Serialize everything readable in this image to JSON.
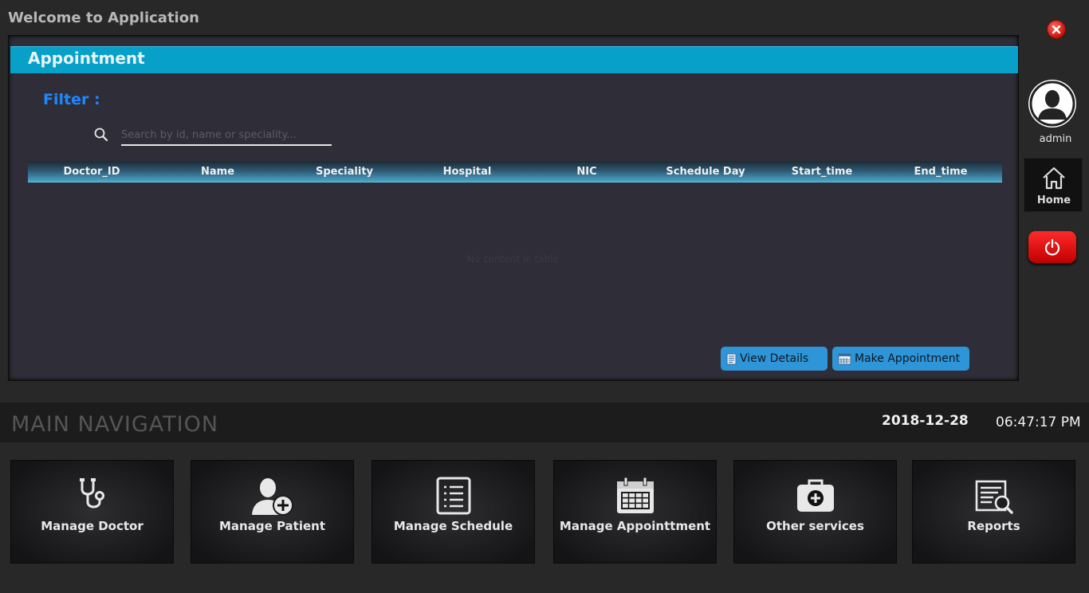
{
  "window": {
    "title": "Welcome to Application"
  },
  "panel": {
    "title": "Appointment",
    "filter_label": "Filter :",
    "search_placeholder": "Search by id, name or speciality...",
    "table": {
      "columns": [
        "Doctor_ID",
        "Name",
        "Speciality",
        "Hospital",
        "NIC",
        "Schedule Day",
        "Start_time",
        "End_time"
      ],
      "empty_text": "No content in table"
    },
    "buttons": {
      "view_details": "View Details",
      "make_appointment": "Make Appointment"
    }
  },
  "user": {
    "name": "admin"
  },
  "sidebar": {
    "home_label": "Home"
  },
  "navigation": {
    "title": "MAIN NAVIGATION",
    "date": "2018-12-28",
    "time": "06:47:17 PM",
    "tiles": [
      {
        "label": "Manage Doctor",
        "icon": "stethoscope-icon"
      },
      {
        "label": "Manage Patient",
        "icon": "add-user-icon"
      },
      {
        "label": "Manage Schedule",
        "icon": "list-icon"
      },
      {
        "label": "Manage Appointtment",
        "icon": "calendar-icon"
      },
      {
        "label": "Other services",
        "icon": "medical-kit-icon"
      },
      {
        "label": "Reports",
        "icon": "report-search-icon"
      }
    ]
  },
  "colors": {
    "accent": "#06a0c8",
    "filter": "#1e88ff",
    "button": "#2d95d8",
    "power": "#e00000"
  }
}
